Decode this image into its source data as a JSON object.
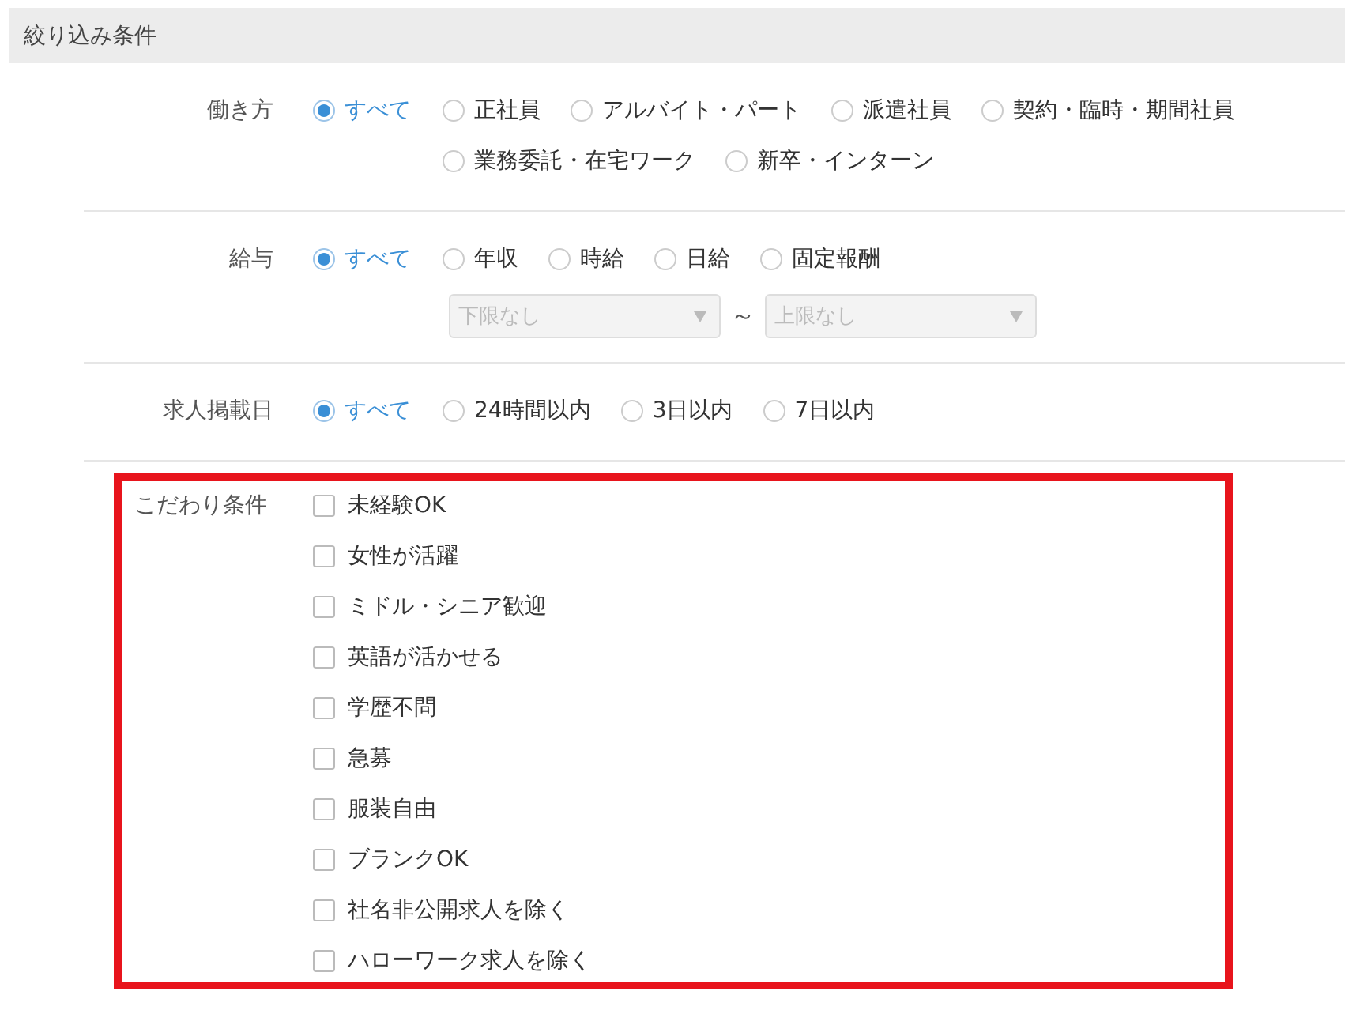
{
  "header": {
    "title": "絞り込み条件"
  },
  "radio_groups": [
    {
      "label": "働き方",
      "options": [
        {
          "label": "すべて",
          "selected": true
        },
        {
          "label": "正社員",
          "selected": false
        },
        {
          "label": "アルバイト・パート",
          "selected": false
        },
        {
          "label": "派遣社員",
          "selected": false
        },
        {
          "label": "契約・臨時・期間社員",
          "selected": false
        },
        {
          "label": "業務委託・在宅ワーク",
          "selected": false
        },
        {
          "label": "新卒・インターン",
          "selected": false
        }
      ]
    },
    {
      "label": "給与",
      "options": [
        {
          "label": "すべて",
          "selected": true
        },
        {
          "label": "年収",
          "selected": false
        },
        {
          "label": "時給",
          "selected": false
        },
        {
          "label": "日給",
          "selected": false
        },
        {
          "label": "固定報酬",
          "selected": false
        }
      ],
      "range": {
        "min": {
          "value": "下限なし",
          "disabled": true
        },
        "separator": "～",
        "max": {
          "value": "上限なし",
          "disabled": true
        }
      }
    },
    {
      "label": "求人掲載日",
      "options": [
        {
          "label": "すべて",
          "selected": true
        },
        {
          "label": "24時間以内",
          "selected": false
        },
        {
          "label": "3日以内",
          "selected": false
        },
        {
          "label": "7日以内",
          "selected": false
        }
      ]
    }
  ],
  "preferences": {
    "label": "こだわり条件",
    "highlighted": true,
    "items": [
      {
        "label": "未経験OK",
        "checked": false
      },
      {
        "label": "女性が活躍",
        "checked": false
      },
      {
        "label": "ミドル・シニア歓迎",
        "checked": false
      },
      {
        "label": "英語が活かせる",
        "checked": false
      },
      {
        "label": "学歴不問",
        "checked": false
      },
      {
        "label": "急募",
        "checked": false
      },
      {
        "label": "服装自由",
        "checked": false
      },
      {
        "label": "ブランクOK",
        "checked": false
      },
      {
        "label": "社名非公開求人を除く",
        "checked": false
      },
      {
        "label": "ハローワーク求人を除く",
        "checked": false
      }
    ]
  }
}
